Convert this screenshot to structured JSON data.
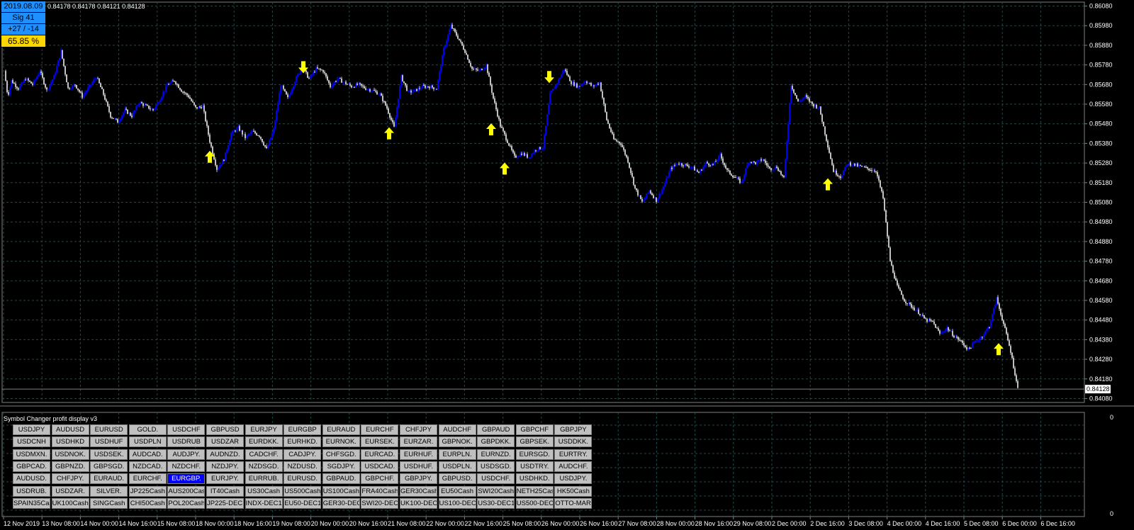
{
  "indicator_box": {
    "date": "2019.08.09",
    "signals": "Sig 41",
    "win_loss": "+27 / -14",
    "percent": "65.85 %"
  },
  "ohlc_readout": "0.84178 0.84178 0.84121 0.84128",
  "colors": {
    "background": "#000000",
    "grid": "#1f4a4a",
    "candle_up": "#0000ff",
    "candle_down": "#c0c0c0",
    "arrow": "#ffff00",
    "button_bg": "#c0c0c0",
    "button_active": "#0000ff"
  },
  "price_axis": [
    "0.86080",
    "0.85980",
    "0.85880",
    "0.85780",
    "0.85680",
    "0.85580",
    "0.85480",
    "0.85380",
    "0.85280",
    "0.85180",
    "0.85080",
    "0.84980",
    "0.84880",
    "0.84780",
    "0.84680",
    "0.84580",
    "0.84480",
    "0.84380",
    "0.84280",
    "0.84180",
    "0.84080"
  ],
  "current_price": "0.84128",
  "time_axis": [
    "12 Nov 2019",
    "13 Nov 08:00",
    "14 Nov 00:00",
    "14 Nov 16:00",
    "15 Nov 08:00",
    "18 Nov 00:00",
    "18 Nov 16:00",
    "19 Nov 08:00",
    "20 Nov 00:00",
    "20 Nov 16:00",
    "21 Nov 08:00",
    "22 Nov 00:00",
    "22 Nov 16:00",
    "25 Nov 08:00",
    "26 Nov 00:00",
    "26 Nov 16:00",
    "27 Nov 08:00",
    "28 Nov 00:00",
    "28 Nov 16:00",
    "29 Nov 08:00",
    "2 Dec 00:00",
    "2 Dec 16:00",
    "3 Dec 08:00",
    "4 Dec 00:00",
    "4 Dec 16:00",
    "5 Dec 08:00",
    "6 Dec 00:00",
    "6 Dec 16:00"
  ],
  "subwindow": {
    "title": "Symbol Changer profit display v3",
    "scale_top": "0",
    "scale_bottom": "0"
  },
  "symbol_buttons": [
    [
      "USDJPY",
      "AUDUSD",
      "EURUSD",
      "GOLD.",
      "USDCHF",
      "GBPUSD",
      "EURJPY",
      "EURGBP",
      "EURAUD",
      "EURCHF",
      "CHFJPY",
      "AUDCHF",
      "GBPAUD",
      "GBPCHF",
      "GBPJPY"
    ],
    [
      "USDCNH",
      "USDHKD",
      "USDHUF",
      "USDPLN",
      "USDRUB",
      "USDZAR",
      "EURDKK.",
      "EURHKD.",
      "EURNOK.",
      "EURSEK.",
      "EURZAR.",
      "GBPNOK.",
      "GBPDKK.",
      "GBPSEK.",
      "USDDKK."
    ],
    [
      "USDMXN.",
      "USDNOK.",
      "USDSEK.",
      "AUDCAD.",
      "AUDJPY.",
      "AUDNZD.",
      "CADCHF.",
      "CADJPY.",
      "CHFSGD.",
      "EURCAD.",
      "EURHUF.",
      "EURPLN.",
      "EURNZD.",
      "EURSGD.",
      "EURTRY."
    ],
    [
      "GBPCAD.",
      "GBPNZD.",
      "GBPSGD.",
      "NZDCAD.",
      "NZDCHF.",
      "NZDJPY.",
      "NZDSGD.",
      "NZDUSD.",
      "SGDJPY.",
      "USDCAD.",
      "USDHUF.",
      "USDPLN.",
      "USDSGD.",
      "USDTRY.",
      "AUDCHF."
    ],
    [
      "AUDUSD.",
      "CHFJPY.",
      "EURAUD.",
      "EURCHF.",
      "EURGBP.",
      "EURJPY.",
      "EURRUB.",
      "EURUSD.",
      "GBPAUD.",
      "GBPCHF.",
      "GBPJPY.",
      "GBPUSD.",
      "USDCHF.",
      "USDHKD.",
      "USDJPY."
    ],
    [
      "USDRUB.",
      "USDZAR.",
      "SILVER.",
      "JP225Cash",
      "AUS200Cash",
      "IT40Cash",
      "US30Cash",
      "US500Cash",
      "US100Cash",
      "FRA40Cash",
      "GER30Cash",
      "EU50Cash",
      "SWI20Cash",
      "NETH25Cash",
      "HK50Cash"
    ],
    [
      "SPAIN35Cash",
      "UK100Cash",
      "SINGCash",
      "CHI50Cash",
      "POL20Cash",
      "JP225-DEC19",
      "INDX-DEC19",
      "EU50-DEC19",
      "GER30-DEC19",
      "SWI20-DEC19",
      "UK100-DEC19",
      "US100-DEC19",
      "US30-DEC19",
      "US500-DEC19",
      "OTTO-MAR20"
    ]
  ],
  "active_symbol": "EURGBP.",
  "chart_data": {
    "type": "candlestick",
    "symbol": "EURGBP",
    "ylim": [
      0.8406,
      0.861
    ],
    "close_path": [
      [
        0,
        0.8575
      ],
      [
        5,
        0.8562
      ],
      [
        10,
        0.857
      ],
      [
        20,
        0.8566
      ],
      [
        30,
        0.8571
      ],
      [
        40,
        0.8568
      ],
      [
        50,
        0.8575
      ],
      [
        60,
        0.8565
      ],
      [
        70,
        0.8572
      ],
      [
        80,
        0.8585
      ],
      [
        90,
        0.8566
      ],
      [
        100,
        0.8568
      ],
      [
        110,
        0.8562
      ],
      [
        120,
        0.8567
      ],
      [
        130,
        0.8572
      ],
      [
        140,
        0.8563
      ],
      [
        150,
        0.8552
      ],
      [
        160,
        0.8549
      ],
      [
        170,
        0.8555
      ],
      [
        180,
        0.8552
      ],
      [
        190,
        0.8559
      ],
      [
        200,
        0.8557
      ],
      [
        210,
        0.8555
      ],
      [
        220,
        0.8561
      ],
      [
        230,
        0.8568
      ],
      [
        240,
        0.857
      ],
      [
        250,
        0.8565
      ],
      [
        260,
        0.8562
      ],
      [
        270,
        0.8556
      ],
      [
        280,
        0.8557
      ],
      [
        290,
        0.8539
      ],
      [
        300,
        0.8525
      ],
      [
        310,
        0.853
      ],
      [
        320,
        0.8543
      ],
      [
        330,
        0.8546
      ],
      [
        340,
        0.8541
      ],
      [
        350,
        0.8544
      ],
      [
        360,
        0.8542
      ],
      [
        370,
        0.8535
      ],
      [
        380,
        0.8545
      ],
      [
        390,
        0.8568
      ],
      [
        400,
        0.8561
      ],
      [
        410,
        0.857
      ],
      [
        420,
        0.8577
      ],
      [
        430,
        0.8571
      ],
      [
        440,
        0.8576
      ],
      [
        450,
        0.8575
      ],
      [
        460,
        0.8567
      ],
      [
        470,
        0.8571
      ],
      [
        480,
        0.8569
      ],
      [
        490,
        0.8567
      ],
      [
        500,
        0.8568
      ],
      [
        510,
        0.8566
      ],
      [
        520,
        0.8565
      ],
      [
        530,
        0.8563
      ],
      [
        540,
        0.8556
      ],
      [
        550,
        0.8546
      ],
      [
        560,
        0.8572
      ],
      [
        570,
        0.8564
      ],
      [
        580,
        0.8565
      ],
      [
        590,
        0.8567
      ],
      [
        600,
        0.8567
      ],
      [
        610,
        0.8566
      ],
      [
        620,
        0.8586
      ],
      [
        630,
        0.8598
      ],
      [
        640,
        0.8592
      ],
      [
        650,
        0.8585
      ],
      [
        660,
        0.8576
      ],
      [
        670,
        0.8575
      ],
      [
        680,
        0.8578
      ],
      [
        690,
        0.8561
      ],
      [
        700,
        0.8547
      ],
      [
        710,
        0.8539
      ],
      [
        720,
        0.8531
      ],
      [
        730,
        0.8533
      ],
      [
        740,
        0.8531
      ],
      [
        750,
        0.8535
      ],
      [
        760,
        0.8536
      ],
      [
        770,
        0.8563
      ],
      [
        780,
        0.8569
      ],
      [
        790,
        0.8576
      ],
      [
        800,
        0.8569
      ],
      [
        810,
        0.8567
      ],
      [
        820,
        0.857
      ],
      [
        830,
        0.8567
      ],
      [
        840,
        0.8569
      ],
      [
        850,
        0.855
      ],
      [
        860,
        0.854
      ],
      [
        870,
        0.8538
      ],
      [
        880,
        0.8529
      ],
      [
        890,
        0.8515
      ],
      [
        900,
        0.8508
      ],
      [
        910,
        0.8514
      ],
      [
        920,
        0.8509
      ],
      [
        930,
        0.8516
      ],
      [
        940,
        0.8525
      ],
      [
        950,
        0.8528
      ],
      [
        960,
        0.8527
      ],
      [
        970,
        0.8526
      ],
      [
        980,
        0.8523
      ],
      [
        990,
        0.8528
      ],
      [
        1000,
        0.8527
      ],
      [
        1010,
        0.8532
      ],
      [
        1020,
        0.8524
      ],
      [
        1030,
        0.8521
      ],
      [
        1040,
        0.8518
      ],
      [
        1050,
        0.8529
      ],
      [
        1060,
        0.8528
      ],
      [
        1070,
        0.853
      ],
      [
        1080,
        0.8525
      ],
      [
        1090,
        0.8526
      ],
      [
        1100,
        0.852
      ],
      [
        1110,
        0.8568
      ],
      [
        1120,
        0.8559
      ],
      [
        1130,
        0.8562
      ],
      [
        1140,
        0.8558
      ],
      [
        1150,
        0.8556
      ],
      [
        1160,
        0.854
      ],
      [
        1170,
        0.8524
      ],
      [
        1180,
        0.8521
      ],
      [
        1190,
        0.8528
      ],
      [
        1200,
        0.8527
      ],
      [
        1210,
        0.8526
      ],
      [
        1220,
        0.8525
      ],
      [
        1230,
        0.8524
      ],
      [
        1240,
        0.851
      ],
      [
        1250,
        0.8478
      ],
      [
        1260,
        0.8465
      ],
      [
        1270,
        0.8458
      ],
      [
        1280,
        0.8455
      ],
      [
        1290,
        0.8452
      ],
      [
        1300,
        0.8448
      ],
      [
        1310,
        0.8447
      ],
      [
        1320,
        0.8441
      ],
      [
        1330,
        0.8444
      ],
      [
        1340,
        0.844
      ],
      [
        1350,
        0.8437
      ],
      [
        1360,
        0.8433
      ],
      [
        1370,
        0.8437
      ],
      [
        1380,
        0.844
      ],
      [
        1390,
        0.8445
      ],
      [
        1400,
        0.8459
      ],
      [
        1410,
        0.8446
      ],
      [
        1420,
        0.8432
      ],
      [
        1430,
        0.8413
      ]
    ],
    "signal_arrows": [
      {
        "x_bar": 296,
        "price": 0.8531,
        "direction": "up"
      },
      {
        "x_bar": 428,
        "price": 0.8577,
        "direction": "down"
      },
      {
        "x_bar": 549,
        "price": 0.8543,
        "direction": "up"
      },
      {
        "x_bar": 693,
        "price": 0.8545,
        "direction": "up"
      },
      {
        "x_bar": 712,
        "price": 0.8525,
        "direction": "up"
      },
      {
        "x_bar": 775,
        "price": 0.8572,
        "direction": "down"
      },
      {
        "x_bar": 1168,
        "price": 0.8517,
        "direction": "up"
      },
      {
        "x_bar": 1409,
        "price": 0.8433,
        "direction": "up"
      }
    ]
  }
}
